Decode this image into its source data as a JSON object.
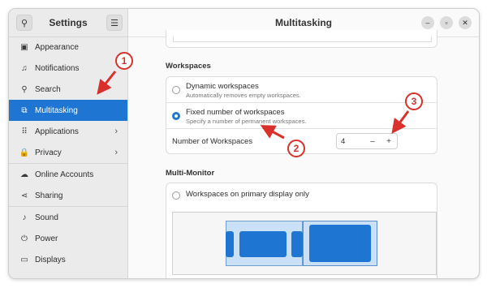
{
  "sidebar": {
    "title": "Settings",
    "items": [
      {
        "label": "Appearance",
        "icon": "appearance-icon",
        "glyph": "▣",
        "chevron": false,
        "active": false
      },
      {
        "label": "Notifications",
        "icon": "bell-icon",
        "glyph": "♫",
        "chevron": false,
        "active": false
      },
      {
        "label": "Search",
        "icon": "search-icon",
        "glyph": "⚲",
        "chevron": false,
        "active": false
      },
      {
        "label": "Multitasking",
        "icon": "multitasking-icon",
        "glyph": "⧉",
        "chevron": false,
        "active": true
      },
      {
        "label": "Applications",
        "icon": "apps-grid-icon",
        "glyph": "⠿",
        "chevron": true,
        "active": false
      },
      {
        "label": "Privacy",
        "icon": "lock-icon",
        "glyph": "🔒",
        "chevron": true,
        "active": false
      },
      {
        "label": "Online Accounts",
        "icon": "cloud-icon",
        "glyph": "☁",
        "chevron": false,
        "active": false
      },
      {
        "label": "Sharing",
        "icon": "share-icon",
        "glyph": "⋖",
        "chevron": false,
        "active": false
      },
      {
        "label": "Sound",
        "icon": "music-note-icon",
        "glyph": "♪",
        "chevron": false,
        "active": false
      },
      {
        "label": "Power",
        "icon": "power-icon",
        "glyph": "⏻",
        "chevron": false,
        "active": false
      },
      {
        "label": "Displays",
        "icon": "display-icon",
        "glyph": "▭",
        "chevron": false,
        "active": false
      }
    ]
  },
  "main": {
    "title": "Multitasking",
    "workspaces": {
      "heading": "Workspaces",
      "dynamic_title": "Dynamic workspaces",
      "dynamic_sub": "Automatically removes empty workspaces.",
      "fixed_title": "Fixed number of workspaces",
      "fixed_sub": "Specify a number of permanent workspaces.",
      "selected": "fixed",
      "count_label": "Number of Workspaces",
      "count_value": "4",
      "minus": "–",
      "plus": "+"
    },
    "multi_monitor": {
      "heading": "Multi-Monitor",
      "option_label": "Workspaces on primary display only"
    }
  },
  "annotations": {
    "badge1": "1",
    "badge2": "2",
    "badge3": "3",
    "color": "#d9302c"
  },
  "colors": {
    "accent": "#1f76d2"
  }
}
